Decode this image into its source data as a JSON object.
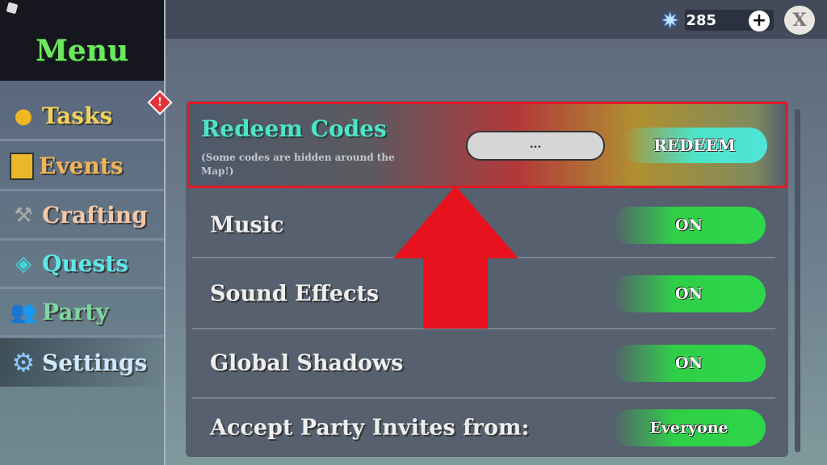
{
  "sidebar": {
    "title": "Menu",
    "items": [
      {
        "label": "Tasks",
        "icon": "coin-icon",
        "color": "#f3d25a"
      },
      {
        "label": "Events",
        "icon": "events-card-icon",
        "color": "#f0b45a"
      },
      {
        "label": "Crafting",
        "icon": "hammer-icon",
        "color": "#f3c7a8"
      },
      {
        "label": "Quests",
        "icon": "quest-exclamation-icon",
        "color": "#5fe6e8"
      },
      {
        "label": "Party",
        "icon": "party-users-icon",
        "color": "#7ed6a0"
      },
      {
        "label": "Settings",
        "icon": "gear-icon",
        "color": "#cfe9ff"
      }
    ],
    "alert": "!"
  },
  "topbar": {
    "currency_value": "285",
    "plus": "+",
    "close": "X"
  },
  "redeem": {
    "title": "Redeem Codes",
    "subtitle": "(Some codes are hidden around the Map!)",
    "input_value": "...",
    "button": "REDEEM"
  },
  "settings": [
    {
      "label": "Music",
      "value": "ON"
    },
    {
      "label": "Sound Effects",
      "value": "ON"
    },
    {
      "label": "Global Shadows",
      "value": "ON"
    },
    {
      "label": "Accept Party Invites from:",
      "value": "Everyone"
    }
  ],
  "colors": {
    "accent": "#4ee4c8",
    "toggle": "#2fcf48",
    "highlight": "#e31a25"
  }
}
